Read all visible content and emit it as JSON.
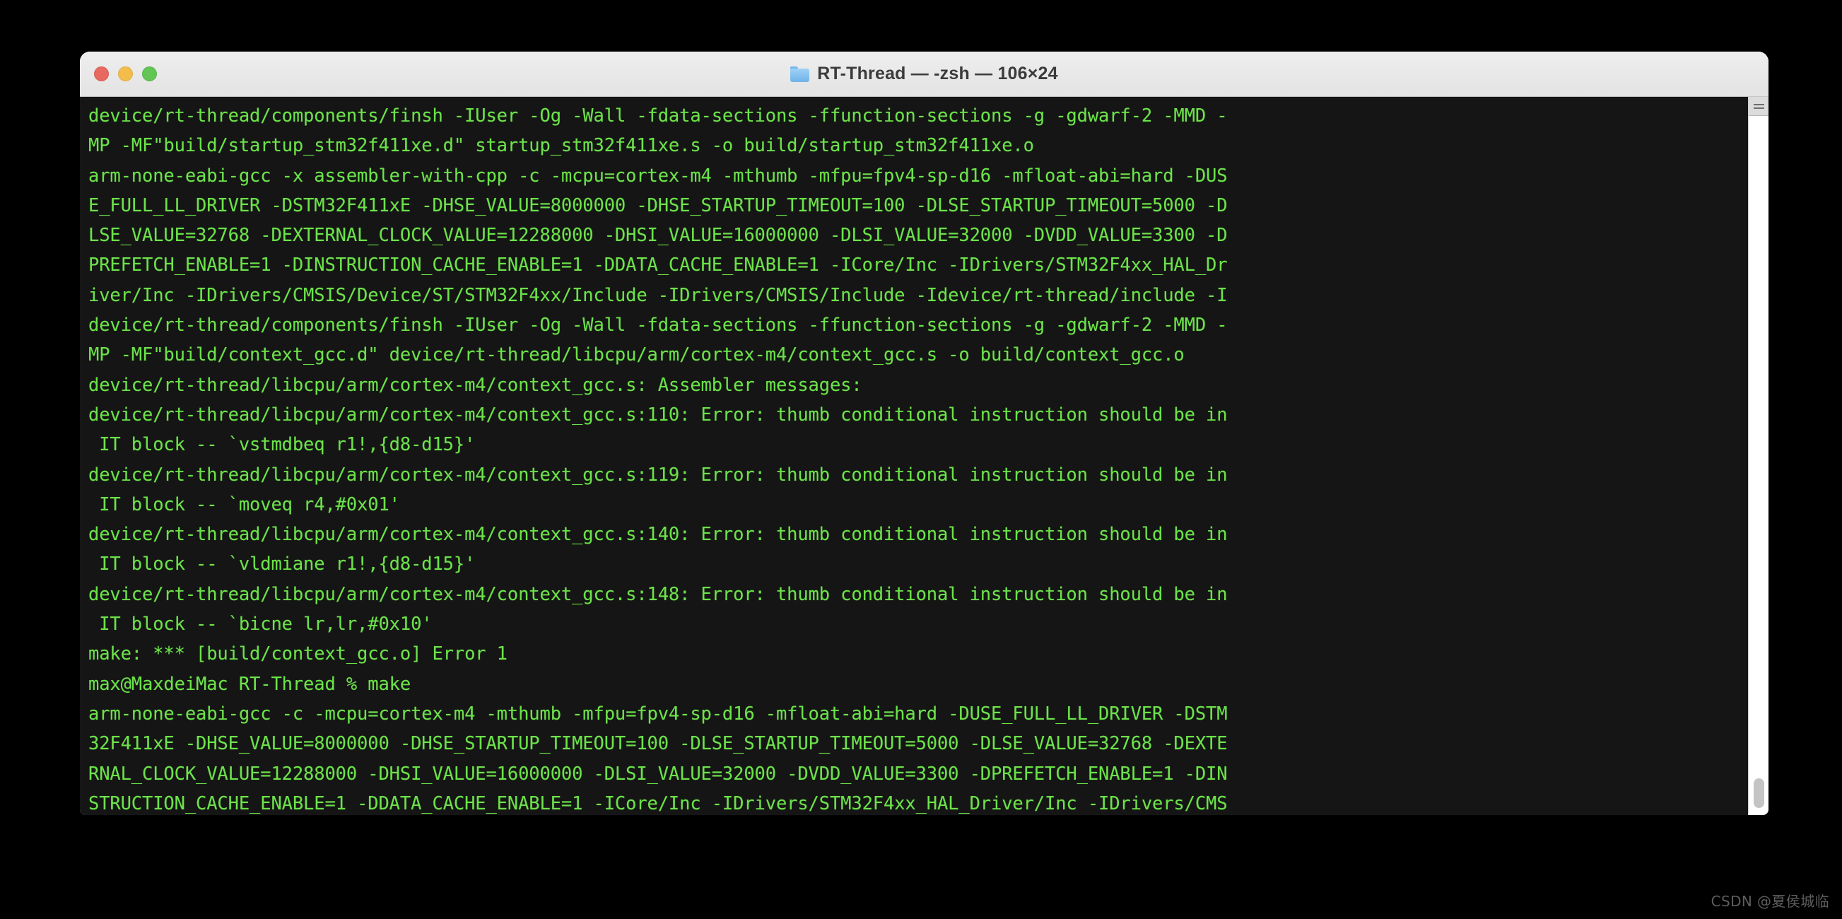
{
  "window": {
    "title": "RT-Thread — -zsh — 106×24",
    "folder_icon": "folder-icon",
    "traffic_lights": [
      {
        "name": "close",
        "color": "#e8695f"
      },
      {
        "name": "minimize",
        "color": "#f3bd4c"
      },
      {
        "name": "maximize",
        "color": "#62c554"
      }
    ]
  },
  "terminal": {
    "columns": 106,
    "rows": 24,
    "shell": "-zsh",
    "working_directory": "RT-Thread",
    "background_color": "#151515",
    "text_color": "#6ce24a",
    "prompt": "max@MaxdeiMac RT-Thread % make",
    "lines": [
      "device/rt-thread/components/finsh -IUser -Og -Wall -fdata-sections -ffunction-sections -g -gdwarf-2 -MMD -",
      "MP -MF\"build/startup_stm32f411xe.d\" startup_stm32f411xe.s -o build/startup_stm32f411xe.o",
      "arm-none-eabi-gcc -x assembler-with-cpp -c -mcpu=cortex-m4 -mthumb -mfpu=fpv4-sp-d16 -mfloat-abi=hard -DUS",
      "E_FULL_LL_DRIVER -DSTM32F411xE -DHSE_VALUE=8000000 -DHSE_STARTUP_TIMEOUT=100 -DLSE_STARTUP_TIMEOUT=5000 -D",
      "LSE_VALUE=32768 -DEXTERNAL_CLOCK_VALUE=12288000 -DHSI_VALUE=16000000 -DLSI_VALUE=32000 -DVDD_VALUE=3300 -D",
      "PREFETCH_ENABLE=1 -DINSTRUCTION_CACHE_ENABLE=1 -DDATA_CACHE_ENABLE=1 -ICore/Inc -IDrivers/STM32F4xx_HAL_Dr",
      "iver/Inc -IDrivers/CMSIS/Device/ST/STM32F4xx/Include -IDrivers/CMSIS/Include -Idevice/rt-thread/include -I",
      "device/rt-thread/components/finsh -IUser -Og -Wall -fdata-sections -ffunction-sections -g -gdwarf-2 -MMD -",
      "MP -MF\"build/context_gcc.d\" device/rt-thread/libcpu/arm/cortex-m4/context_gcc.s -o build/context_gcc.o",
      "device/rt-thread/libcpu/arm/cortex-m4/context_gcc.s: Assembler messages:",
      "device/rt-thread/libcpu/arm/cortex-m4/context_gcc.s:110: Error: thumb conditional instruction should be in",
      " IT block -- `vstmdbeq r1!,{d8-d15}'",
      "device/rt-thread/libcpu/arm/cortex-m4/context_gcc.s:119: Error: thumb conditional instruction should be in",
      " IT block -- `moveq r4,#0x01'",
      "device/rt-thread/libcpu/arm/cortex-m4/context_gcc.s:140: Error: thumb conditional instruction should be in",
      " IT block -- `vldmiane r1!,{d8-d15}'",
      "device/rt-thread/libcpu/arm/cortex-m4/context_gcc.s:148: Error: thumb conditional instruction should be in",
      " IT block -- `bicne lr,lr,#0x10'",
      "make: *** [build/context_gcc.o] Error 1",
      "max@MaxdeiMac RT-Thread % make",
      "arm-none-eabi-gcc -c -mcpu=cortex-m4 -mthumb -mfpu=fpv4-sp-d16 -mfloat-abi=hard -DUSE_FULL_LL_DRIVER -DSTM",
      "32F411xE -DHSE_VALUE=8000000 -DHSE_STARTUP_TIMEOUT=100 -DLSE_STARTUP_TIMEOUT=5000 -DLSE_VALUE=32768 -DEXTE",
      "RNAL_CLOCK_VALUE=12288000 -DHSI_VALUE=16000000 -DLSI_VALUE=32000 -DVDD_VALUE=3300 -DPREFETCH_ENABLE=1 -DIN",
      "STRUCTION_CACHE_ENABLE=1 -DDATA_CACHE_ENABLE=1 -ICore/Inc -IDrivers/STM32F4xx_HAL_Driver/Inc -IDrivers/CMS"
    ]
  },
  "scrollbar": {
    "resize_grip_icon": "resize-grip-icon",
    "thumb_position": "bottom"
  },
  "watermark": {
    "text": "CSDN @夏侯城临"
  }
}
